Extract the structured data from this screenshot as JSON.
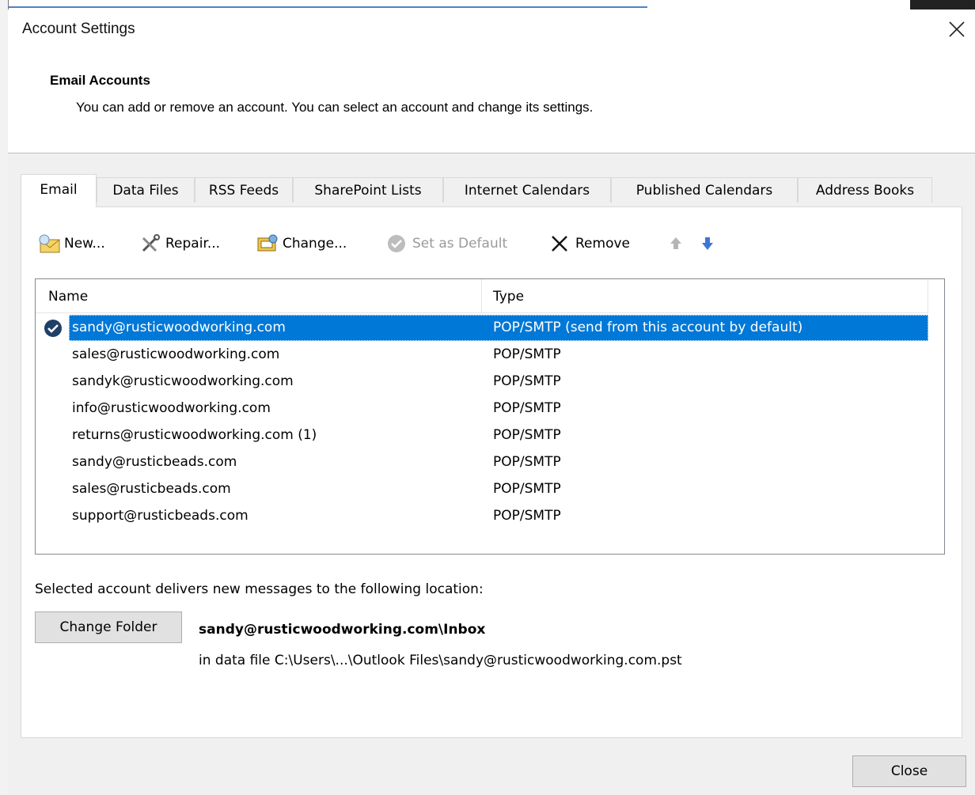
{
  "dialog": {
    "title": "Account Settings",
    "close_glyph": "×"
  },
  "header": {
    "title": "Email Accounts",
    "description": "You can add or remove an account. You can select an account and change its settings."
  },
  "tabs": [
    {
      "label": "Email",
      "active": true
    },
    {
      "label": "Data Files"
    },
    {
      "label": "RSS Feeds"
    },
    {
      "label": "SharePoint Lists"
    },
    {
      "label": "Internet Calendars"
    },
    {
      "label": "Published Calendars"
    },
    {
      "label": "Address Books"
    }
  ],
  "toolbar": {
    "new_label": "New...",
    "repair_label": "Repair...",
    "change_label": "Change...",
    "set_default_label": "Set as Default",
    "remove_label": "Remove"
  },
  "list": {
    "columns": {
      "name": "Name",
      "type": "Type"
    },
    "rows": [
      {
        "name": "sandy@rusticwoodworking.com",
        "type": "POP/SMTP (send from this account by default)",
        "selected": true
      },
      {
        "name": "sales@rusticwoodworking.com",
        "type": "POP/SMTP"
      },
      {
        "name": "sandyk@rusticwoodworking.com",
        "type": "POP/SMTP"
      },
      {
        "name": "info@rusticwoodworking.com",
        "type": "POP/SMTP"
      },
      {
        "name": "returns@rusticwoodworking.com (1)",
        "type": "POP/SMTP"
      },
      {
        "name": "sandy@rusticbeads.com",
        "type": "POP/SMTP"
      },
      {
        "name": "sales@rusticbeads.com",
        "type": "POP/SMTP"
      },
      {
        "name": "support@rusticbeads.com",
        "type": "POP/SMTP"
      }
    ]
  },
  "location": {
    "label": "Selected account delivers new messages to the following location:",
    "change_folder_label": "Change Folder",
    "path": "sandy@rusticwoodworking.com\\Inbox",
    "data_file": "in data file C:\\Users\\...\\Outlook Files\\sandy@rusticwoodworking.com.pst"
  },
  "footer": {
    "close_label": "Close"
  },
  "colors": {
    "selection": "#0078d7",
    "arrow_blue": "#3b78d8",
    "default_check": "#1f3f66"
  }
}
